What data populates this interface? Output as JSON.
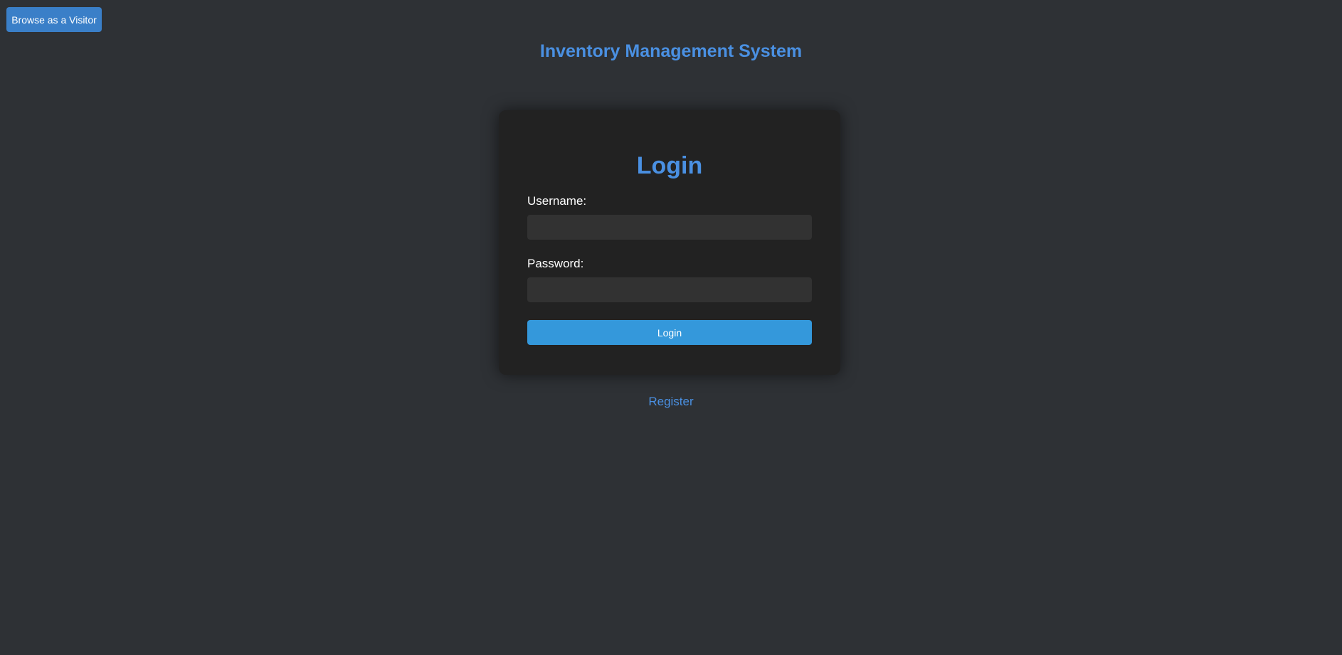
{
  "header": {
    "visitor_button_label": "Browse as a Visitor",
    "app_title": "Inventory Management System"
  },
  "login_form": {
    "title": "Login",
    "username_label": "Username:",
    "username_value": "",
    "username_placeholder": "",
    "password_label": "Password:",
    "password_value": "",
    "password_placeholder": "",
    "submit_label": "Login"
  },
  "footer": {
    "register_link_label": "Register"
  },
  "colors": {
    "background": "#2e3135",
    "card_background": "#222222",
    "accent": "#4a90e2",
    "primary_button": "#3498db",
    "visitor_button": "#3a7fc8",
    "input_background": "#323232"
  }
}
